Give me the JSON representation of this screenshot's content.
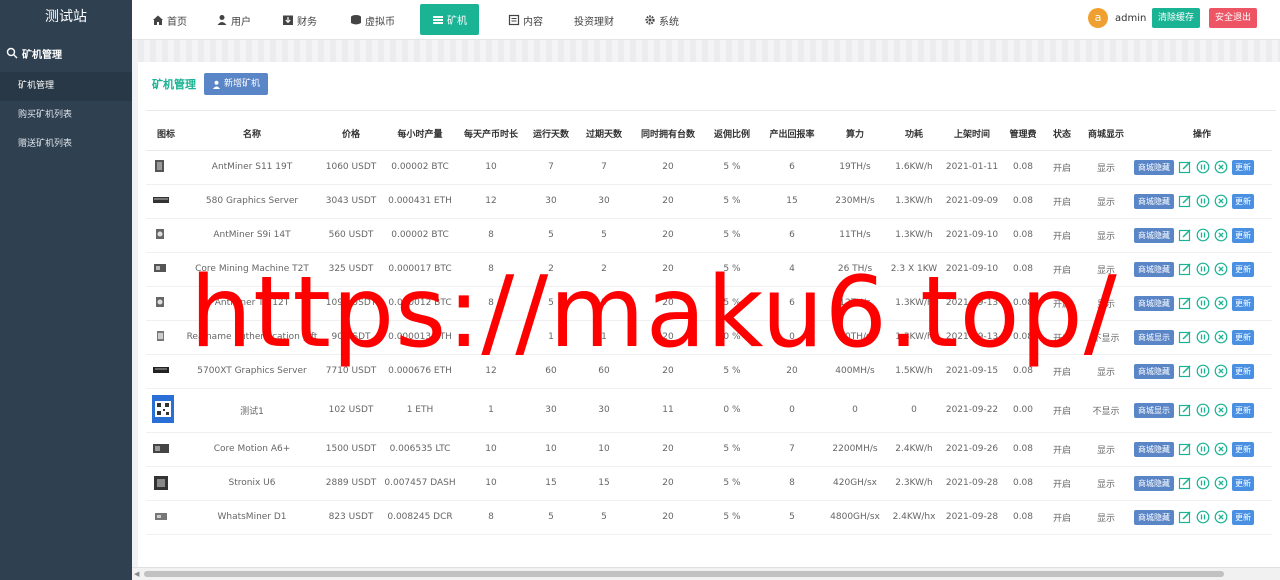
{
  "site_title": "测试站",
  "sidebar": {
    "section": "矿机管理",
    "items": [
      {
        "label": "矿机管理",
        "active": true
      },
      {
        "label": "购买矿机列表",
        "active": false
      },
      {
        "label": "赠送矿机列表",
        "active": false
      }
    ]
  },
  "nav": [
    {
      "label": "首页",
      "icon": "home-icon"
    },
    {
      "label": "用户",
      "icon": "user-icon"
    },
    {
      "label": "财务",
      "icon": "finance-icon"
    },
    {
      "label": "虚拟币",
      "icon": "coin-icon"
    },
    {
      "label": "矿机",
      "icon": "miner-icon",
      "active": true
    },
    {
      "label": "内容",
      "icon": "content-icon"
    },
    {
      "label": "投资理财",
      "icon": ""
    },
    {
      "label": "系统",
      "icon": "gear-icon"
    }
  ],
  "user": {
    "avatar_letter": "a",
    "name": "admin"
  },
  "top_buttons": {
    "clear_cache": "清除缓存",
    "logout": "安全退出"
  },
  "panel": {
    "title": "矿机管理",
    "add_button": "新增矿机"
  },
  "table": {
    "headers": [
      "图标",
      "名称",
      "价格",
      "每小时产量",
      "每天产币时长",
      "运行天数",
      "过期天数",
      "同时拥有台数",
      "返佣比例",
      "产出回报率",
      "算力",
      "功耗",
      "上架时间",
      "管理费",
      "状态",
      "商城显示",
      "操作"
    ],
    "rows": [
      {
        "name": "AntMiner S11 19T",
        "price": "1060 USDT",
        "output": "0.00002 BTC",
        "hours": "10",
        "run_days": "7",
        "expire_days": "7",
        "max_own": "20",
        "rebate": "5 %",
        "return_rate": "6",
        "hashrate": "19TH/s",
        "power": "1.6KW/h",
        "date": "2021-01-11",
        "fee": "0.08",
        "status": "开启",
        "mall": "显示",
        "mall_btn": "商城隐藏",
        "more": "更新"
      },
      {
        "name": "580 Graphics Server",
        "price": "3043 USDT",
        "output": "0.000431 ETH",
        "hours": "12",
        "run_days": "30",
        "expire_days": "30",
        "max_own": "20",
        "rebate": "5 %",
        "return_rate": "15",
        "hashrate": "230MH/s",
        "power": "1.3KW/h",
        "date": "2021-09-09",
        "fee": "0.08",
        "status": "开启",
        "mall": "显示",
        "mall_btn": "商城隐藏",
        "more": "更新"
      },
      {
        "name": "AntMiner S9i 14T",
        "price": "560 USDT",
        "output": "0.00002 BTC",
        "hours": "8",
        "run_days": "5",
        "expire_days": "5",
        "max_own": "20",
        "rebate": "5 %",
        "return_rate": "6",
        "hashrate": "11TH/s",
        "power": "1.3KW/h",
        "date": "2021-09-10",
        "fee": "0.08",
        "status": "开启",
        "mall": "显示",
        "mall_btn": "商城隐藏",
        "more": "更新"
      },
      {
        "name": "Core Mining Machine T2T",
        "price": "325 USDT",
        "output": "0.000017 BTC",
        "hours": "8",
        "run_days": "2",
        "expire_days": "2",
        "max_own": "20",
        "rebate": "5 %",
        "return_rate": "4",
        "hashrate": "26 TH/s",
        "power": "2.3 X 1KW",
        "date": "2021-09-10",
        "fee": "0.08",
        "status": "开启",
        "mall": "显示",
        "mall_btn": "商城隐藏",
        "more": "更新"
      },
      {
        "name": "AntMiner T9 12T",
        "price": "1091 USDT",
        "output": "0.000012 BTC",
        "hours": "8",
        "run_days": "5",
        "expire_days": "5",
        "max_own": "20",
        "rebate": "5 %",
        "return_rate": "6",
        "hashrate": "12TH/s",
        "power": "1.3KW/h",
        "date": "2021-09-13",
        "fee": "0.08",
        "status": "开启",
        "mall": "显示",
        "mall_btn": "商城隐藏",
        "more": "更新"
      },
      {
        "name": "Realname authentication gift",
        "price": "90 USDT",
        "output": "0.000013 ETH",
        "hours": "8",
        "run_days": "1",
        "expire_days": "1",
        "max_own": "20",
        "rebate": "0 %",
        "return_rate": "0",
        "hashrate": "10TH/s",
        "power": "1.3KW/h",
        "date": "2021-09-13",
        "fee": "0.08",
        "status": "开启",
        "mall": "不显示",
        "mall_btn": "商城显示",
        "more": "更新"
      },
      {
        "name": "5700XT Graphics Server",
        "price": "7710 USDT",
        "output": "0.000676 ETH",
        "hours": "12",
        "run_days": "60",
        "expire_days": "60",
        "max_own": "20",
        "rebate": "5 %",
        "return_rate": "20",
        "hashrate": "400MH/s",
        "power": "1.5KW/h",
        "date": "2021-09-15",
        "fee": "0.08",
        "status": "开启",
        "mall": "显示",
        "mall_btn": "商城隐藏",
        "more": "更新"
      },
      {
        "name": "测试1",
        "price": "102 USDT",
        "output": "1 ETH",
        "hours": "1",
        "run_days": "30",
        "expire_days": "30",
        "max_own": "11",
        "rebate": "0 %",
        "return_rate": "0",
        "hashrate": "0",
        "power": "0",
        "date": "2021-09-22",
        "fee": "0.00",
        "status": "开启",
        "mall": "不显示",
        "mall_btn": "商城显示",
        "more": "更新"
      },
      {
        "name": "Core Motion A6+",
        "price": "1500 USDT",
        "output": "0.006535 LTC",
        "hours": "10",
        "run_days": "10",
        "expire_days": "10",
        "max_own": "20",
        "rebate": "5 %",
        "return_rate": "7",
        "hashrate": "2200MH/s",
        "power": "2.4KW/h",
        "date": "2021-09-26",
        "fee": "0.08",
        "status": "开启",
        "mall": "显示",
        "mall_btn": "商城隐藏",
        "more": "更新"
      },
      {
        "name": "Stronix U6",
        "price": "2889 USDT",
        "output": "0.007457 DASH",
        "hours": "10",
        "run_days": "15",
        "expire_days": "15",
        "max_own": "20",
        "rebate": "5 %",
        "return_rate": "8",
        "hashrate": "420GH/sx",
        "power": "2.3KW/h",
        "date": "2021-09-28",
        "fee": "0.08",
        "status": "开启",
        "mall": "显示",
        "mall_btn": "商城隐藏",
        "more": "更新"
      },
      {
        "name": "WhatsMiner D1",
        "price": "823 USDT",
        "output": "0.008245 DCR",
        "hours": "8",
        "run_days": "5",
        "expire_days": "5",
        "max_own": "20",
        "rebate": "5 %",
        "return_rate": "5",
        "hashrate": "4800GH/sx",
        "power": "2.4KW/hx",
        "date": "2021-09-28",
        "fee": "0.08",
        "status": "开启",
        "mall": "显示",
        "mall_btn": "商城隐藏",
        "more": "更新"
      }
    ]
  },
  "watermark": "https://maku6.top/",
  "colors": {
    "sidebar": "#2f4050",
    "accent": "#1ab394",
    "button_blue": "#5a85c6",
    "danger": "#ed5565",
    "watermark": "#ff0000"
  }
}
